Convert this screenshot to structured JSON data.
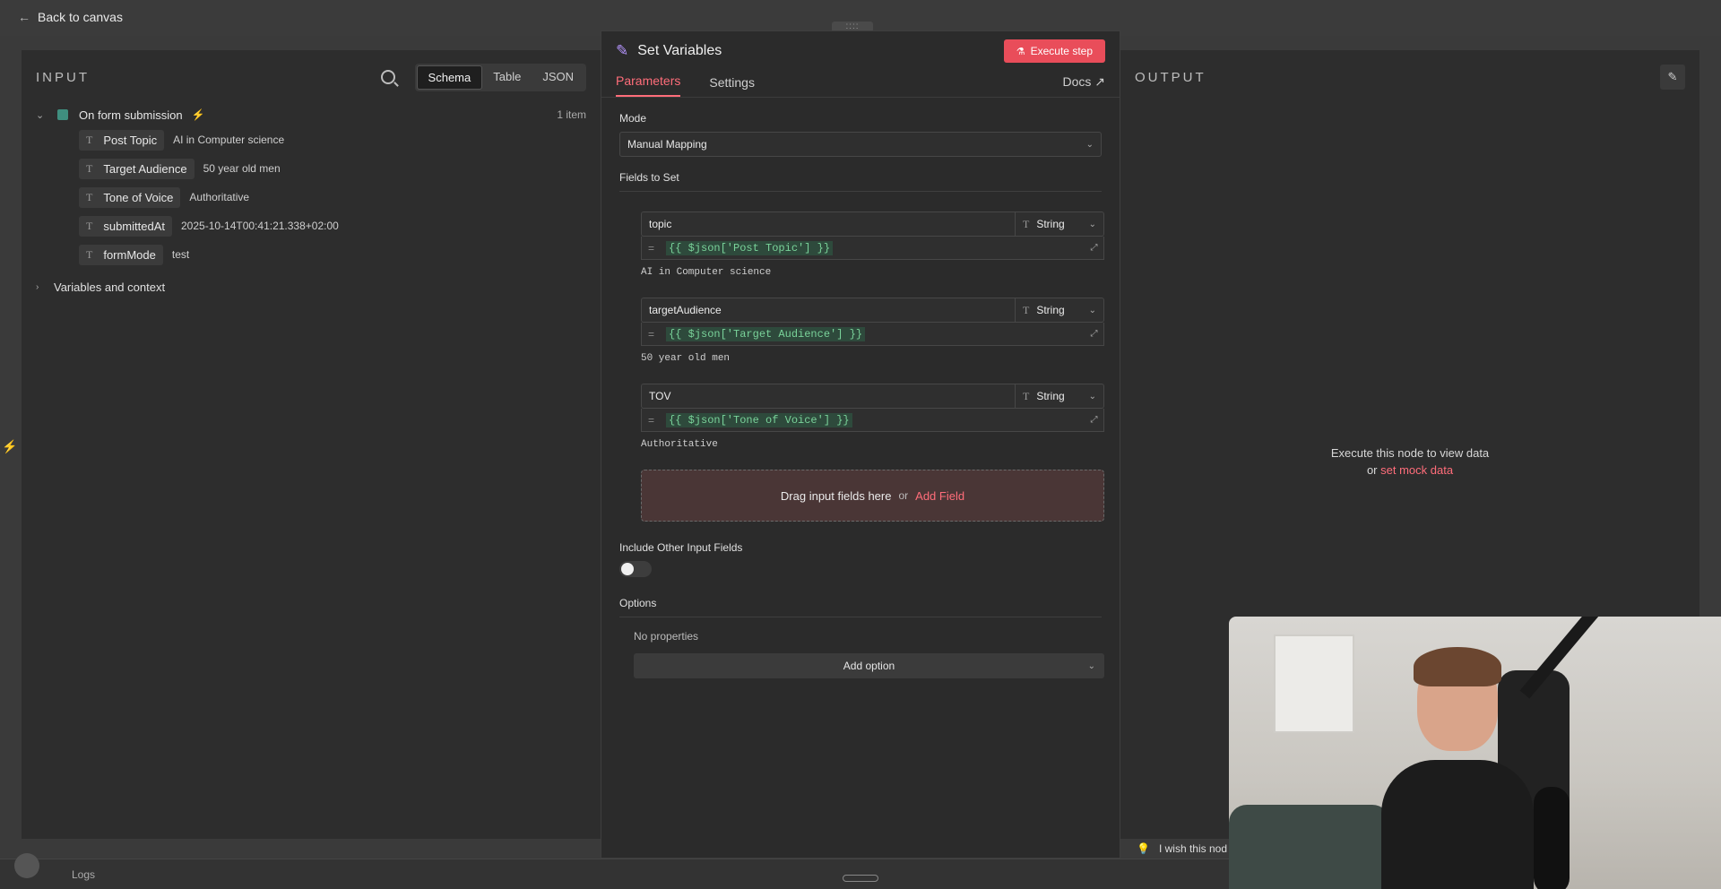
{
  "topbar": {
    "back_label": "Back to canvas",
    "drag_grip": "::::"
  },
  "input_panel": {
    "title": "INPUT",
    "view_modes": [
      "Schema",
      "Table",
      "JSON"
    ],
    "active_view": "Schema",
    "root": {
      "label": "On form submission",
      "count": "1 item"
    },
    "fields": [
      {
        "name": "Post Topic",
        "value": "AI in Computer science"
      },
      {
        "name": "Target Audience",
        "value": "50 year old men"
      },
      {
        "name": "Tone of Voice",
        "value": "Authoritative"
      },
      {
        "name": "submittedAt",
        "value": "2025-10-14T00:41:21.338+02:00"
      },
      {
        "name": "formMode",
        "value": "test"
      }
    ],
    "vars_label": "Variables and context"
  },
  "node": {
    "title": "Set Variables",
    "execute_label": "Execute step",
    "tabs": [
      "Parameters",
      "Settings"
    ],
    "active_tab": "Parameters",
    "docs_label": "Docs ↗",
    "mode_label": "Mode",
    "mode_value": "Manual Mapping",
    "fields_label": "Fields to Set",
    "assignments": [
      {
        "name": "topic",
        "type": "String",
        "expr": "{{ $json['Post Topic'] }}",
        "preview": "AI in Computer science"
      },
      {
        "name": "targetAudience",
        "type": "String",
        "expr": "{{ $json['Target Audience'] }}",
        "preview": "50 year old men"
      },
      {
        "name": "TOV",
        "type": "String",
        "expr": "{{ $json['Tone of Voice'] }}",
        "preview": "Authoritative"
      }
    ],
    "dropzone": {
      "text": "Drag input fields here",
      "or": "or",
      "add": "Add Field"
    },
    "include_label": "Include Other Input Fields",
    "include_value": false,
    "options_label": "Options",
    "no_props": "No properties",
    "add_option": "Add option"
  },
  "output_panel": {
    "title": "OUTPUT",
    "msg_line1": "Execute this node to view data",
    "msg_or": "or",
    "mock_link": "set mock data"
  },
  "footer": {
    "logs_label": "Logs",
    "wish_text": "I wish this nod"
  },
  "colors": {
    "accent": "#ff6d7a",
    "execute_bg": "#e94d5a",
    "panel_bg": "#2d2d2d",
    "expr_green": "#7ad39a"
  }
}
